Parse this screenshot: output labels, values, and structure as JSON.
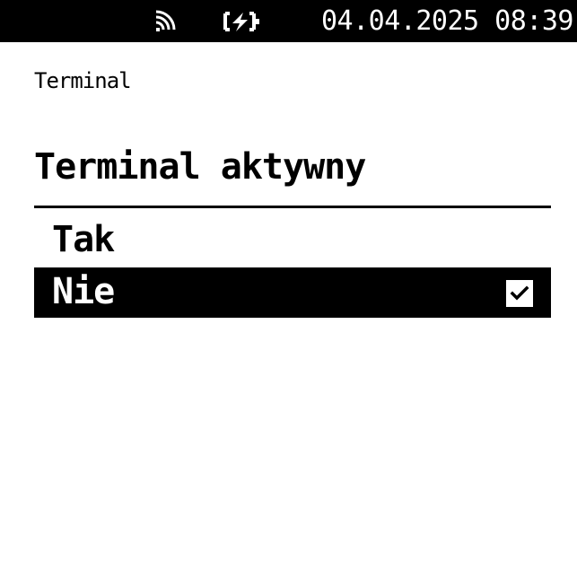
{
  "status_bar": {
    "wifi_icon": "wifi-icon",
    "battery_icon": "battery-charging-icon",
    "datetime": "04.04.2025  08:39"
  },
  "breadcrumb": "Terminal",
  "page_title": "Terminal aktywny",
  "options": [
    {
      "label": "Tak",
      "selected": false
    },
    {
      "label": "Nie",
      "selected": true,
      "check_icon": "checkmark-icon"
    }
  ],
  "colors": {
    "background": "#ffffff",
    "foreground": "#000000",
    "selected_bg": "#000000",
    "selected_fg": "#ffffff"
  }
}
